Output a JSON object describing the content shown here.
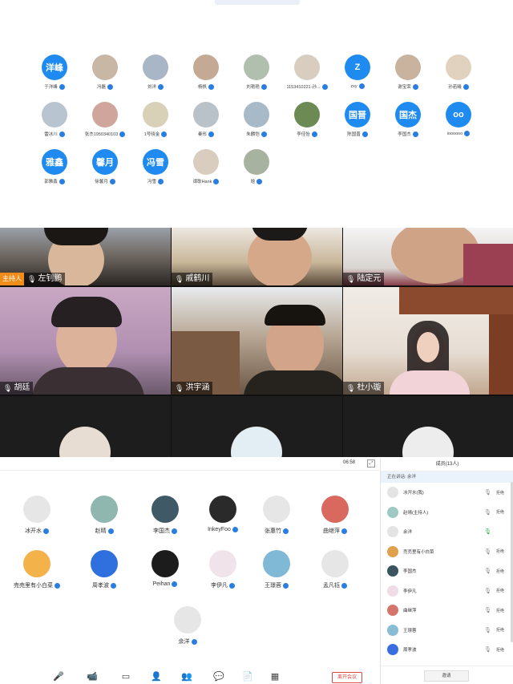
{
  "avatar_grid": {
    "people": [
      {
        "name": "于洋峰",
        "initials": "洋峰",
        "kind": "blue"
      },
      {
        "name": "冯磊",
        "initials": "",
        "kind": "photo"
      },
      {
        "name": "刘洋",
        "initials": "",
        "kind": "photo"
      },
      {
        "name": "杨帆",
        "initials": "",
        "kind": "photo"
      },
      {
        "name": "刘艳艳",
        "initials": "",
        "kind": "photo"
      },
      {
        "name": "1153410221-孙...",
        "initials": "",
        "kind": "photo"
      },
      {
        "name": "zxy",
        "initials": "Z",
        "kind": "blue"
      },
      {
        "name": "谢宝荣",
        "initials": "",
        "kind": "photo"
      },
      {
        "name": "孙若曦",
        "initials": "",
        "kind": "photo"
      },
      {
        "name": "雷冰川",
        "initials": "",
        "kind": "photo"
      },
      {
        "name": "张杰1950340103",
        "initials": "",
        "kind": "photo"
      },
      {
        "name": "1号晓金",
        "initials": "",
        "kind": "photo"
      },
      {
        "name": "秦彤",
        "initials": "",
        "kind": "photo"
      },
      {
        "name": "朱麟恺",
        "initials": "",
        "kind": "photo"
      },
      {
        "name": "李佳怡",
        "initials": "",
        "kind": "photo"
      },
      {
        "name": "陈国晋",
        "initials": "国晋",
        "kind": "blue"
      },
      {
        "name": "李国杰",
        "initials": "国杰",
        "kind": "blue"
      },
      {
        "name": "ioooooo",
        "initials": "oo",
        "kind": "blue"
      },
      {
        "name": "郭雅鑫",
        "initials": "雅鑫",
        "kind": "blue"
      },
      {
        "name": "徐馨月",
        "initials": "馨月",
        "kind": "blue"
      },
      {
        "name": "冯雪",
        "initials": "冯雪",
        "kind": "blue"
      },
      {
        "name": "谭耿Hank",
        "initials": "",
        "kind": "photo"
      },
      {
        "name": "晗",
        "initials": "",
        "kind": "photo"
      }
    ]
  },
  "video_grid": {
    "host_tag": "主持人",
    "tiles": [
      {
        "name": "左钊鹏",
        "host": true
      },
      {
        "name": "戚鹤川",
        "host": false
      },
      {
        "name": "陆定元",
        "host": false
      },
      {
        "name": "胡廷",
        "host": false
      },
      {
        "name": "洪宇涵",
        "host": false
      },
      {
        "name": "杜小璇",
        "host": false
      }
    ]
  },
  "meeting": {
    "time": "06:58",
    "participants": [
      {
        "name": "冰开水"
      },
      {
        "name": "赵晴"
      },
      {
        "name": "李国杰"
      },
      {
        "name": "InkeyFoo"
      },
      {
        "name": "张惠竹"
      },
      {
        "name": "曲继萍"
      },
      {
        "name": "売売里有小白菜"
      },
      {
        "name": "周孝波"
      },
      {
        "name": "Peihan"
      },
      {
        "name": "李伊凡"
      },
      {
        "name": "王璟蓉"
      },
      {
        "name": "孟凡钰"
      },
      {
        "name": "余洋"
      }
    ],
    "toolbar": {
      "end_meeting": "离开会议",
      "icons": [
        "microphone-icon",
        "camera-icon",
        "share-screen-icon",
        "invite-icon",
        "members-icon",
        "chat-icon",
        "document-icon",
        "apps-icon"
      ]
    },
    "members_panel": {
      "title": "成员(13人)",
      "speaking": "正在讲话: 余洋",
      "invite_label": "邀请",
      "members": [
        {
          "name": "冰开水(我)",
          "action": "拒绝",
          "active": false
        },
        {
          "name": "赵晴(主持人)",
          "action": "拒绝",
          "active": false
        },
        {
          "name": "余洋",
          "action": "",
          "active": true
        },
        {
          "name": "売売里有小白菜",
          "action": "拒绝",
          "active": false
        },
        {
          "name": "李国杰",
          "action": "拒绝",
          "active": false
        },
        {
          "name": "李伊凡",
          "action": "拒绝",
          "active": false
        },
        {
          "name": "曲继萍",
          "action": "拒绝",
          "active": false
        },
        {
          "name": "王璟蓉",
          "action": "拒绝",
          "active": false
        },
        {
          "name": "周孝波",
          "action": "拒绝",
          "active": false
        }
      ]
    }
  }
}
